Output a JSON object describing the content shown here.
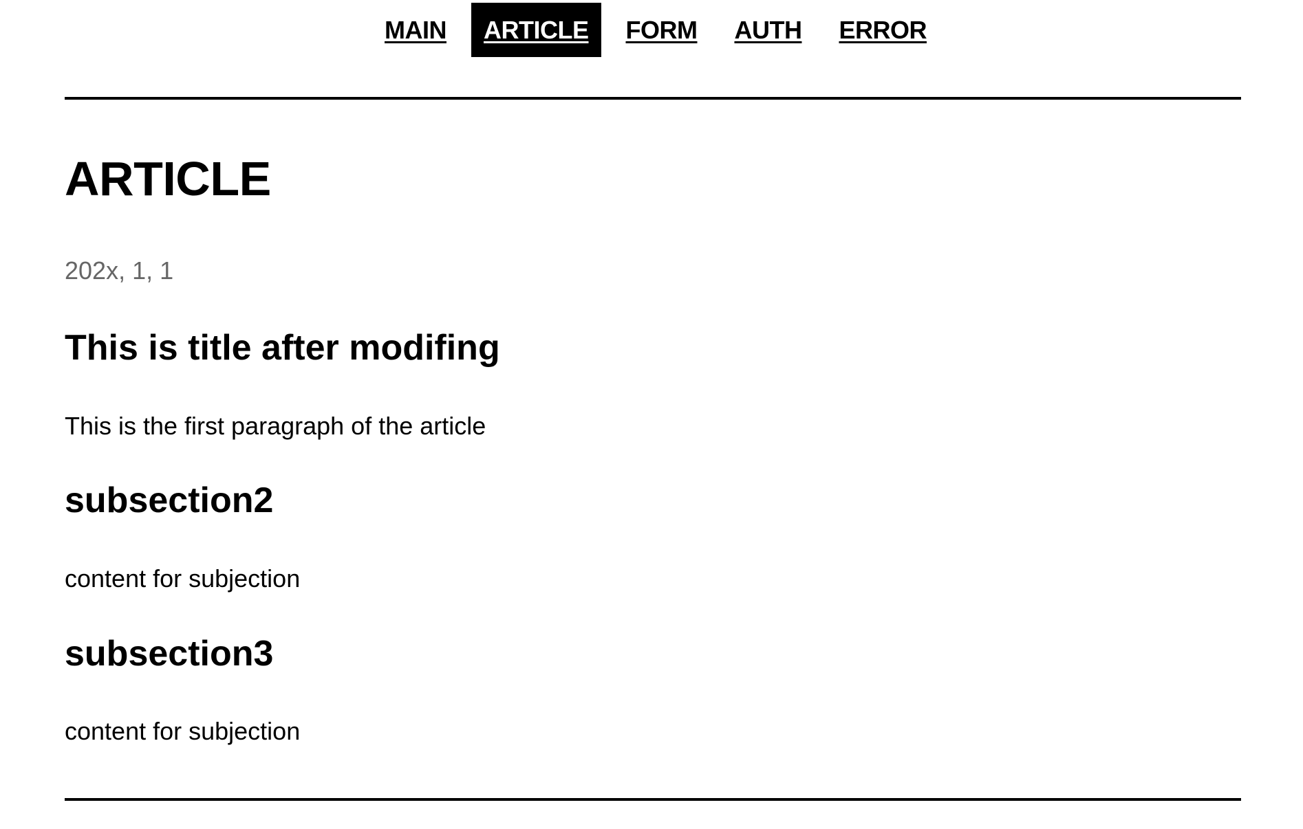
{
  "nav": {
    "items": [
      {
        "label": "MAIN",
        "active": false
      },
      {
        "label": "ARTICLE",
        "active": true
      },
      {
        "label": "FORM",
        "active": false
      },
      {
        "label": "AUTH",
        "active": false
      },
      {
        "label": "ERROR",
        "active": false
      }
    ]
  },
  "page": {
    "title": "ARTICLE"
  },
  "article": {
    "date": "202x, 1, 1",
    "title": "This is title after modifing",
    "first_paragraph": "This is the first paragraph of the article",
    "sections": [
      {
        "heading": "subsection2",
        "content": "content for subjection"
      },
      {
        "heading": "subsection3",
        "content": "content for subjection"
      }
    ]
  },
  "colors": {
    "text": "#000000",
    "muted": "#666666",
    "background": "#ffffff",
    "active_nav_bg": "#000000",
    "active_nav_text": "#ffffff"
  }
}
